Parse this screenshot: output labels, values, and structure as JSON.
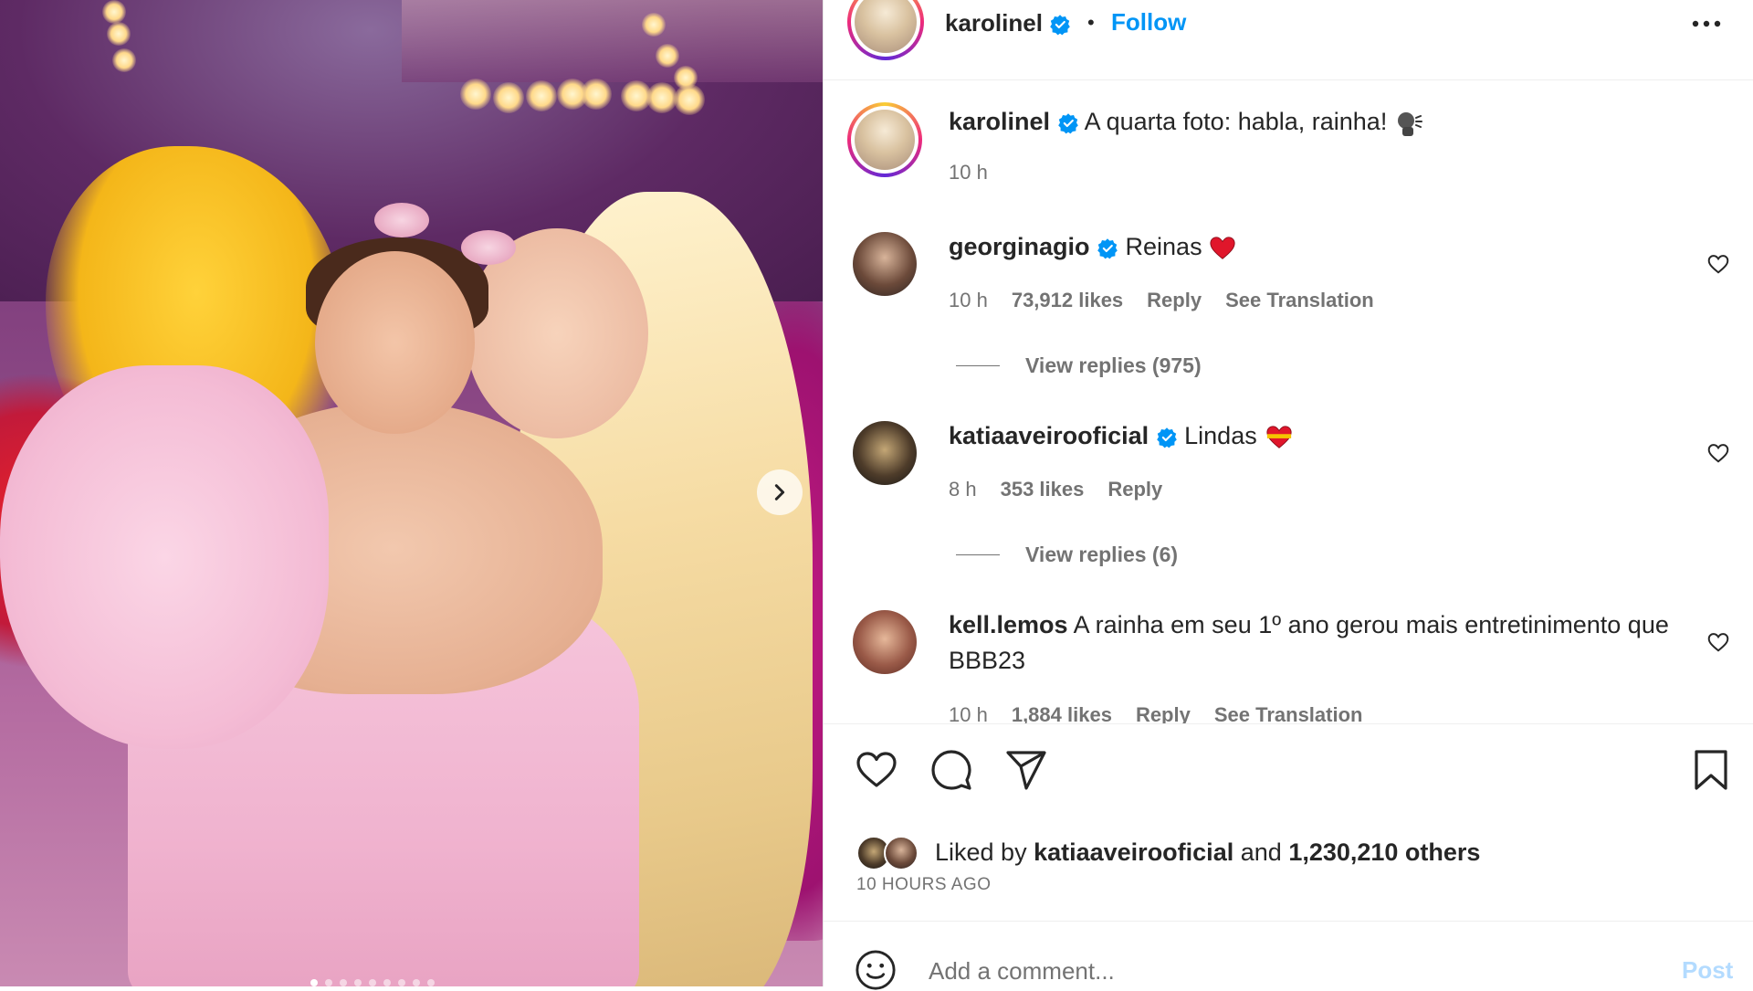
{
  "post_owner": {
    "username": "karolinel",
    "follow_label": "Follow",
    "separator": "•"
  },
  "caption": {
    "username": "karolinel",
    "text": "A quarta foto: habla, rainha!",
    "time": "10 h"
  },
  "comments": [
    {
      "username": "georginagio",
      "text": "Reinas",
      "time": "10 h",
      "likes": "73,912 likes",
      "reply_label": "Reply",
      "translation_label": "See Translation",
      "view_replies": "View replies (975)"
    },
    {
      "username": "katiaaveirooficial",
      "text": "Lindas",
      "time": "8 h",
      "likes": "353 likes",
      "reply_label": "Reply",
      "view_replies": "View replies (6)"
    },
    {
      "username": "kell.lemos",
      "text": "A rainha em seu 1º ano gerou mais entretinimento que BBB23",
      "time": "10 h",
      "likes": "1,884 likes",
      "reply_label": "Reply",
      "translation_label": "See Translation"
    }
  ],
  "likes": {
    "prefix": "Liked by",
    "user": "katiaaveirooficial",
    "and": "and",
    "others": "1,230,210 others"
  },
  "posted_ago": "10 HOURS AGO",
  "add_comment": {
    "placeholder": "Add a comment...",
    "post_label": "Post"
  },
  "icons": [
    "verified-badge-icon",
    "more-options-icon",
    "heart-icon",
    "comment-icon",
    "share-icon",
    "bookmark-icon",
    "emoji-icon",
    "chevron-right-icon"
  ],
  "colors": {
    "accent": "#0095f6",
    "text": "#262626",
    "muted": "#737373",
    "post_disabled": "#b3dbff",
    "verified": "#0095f6"
  }
}
